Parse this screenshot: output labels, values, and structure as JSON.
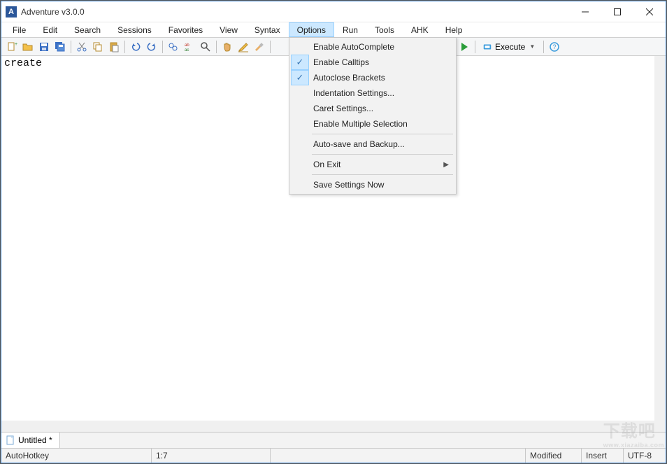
{
  "window": {
    "title": "Adventure v3.0.0",
    "app_icon_letter": "A"
  },
  "menubar": {
    "items": [
      "File",
      "Edit",
      "Search",
      "Sessions",
      "Favorites",
      "View",
      "Syntax",
      "Options",
      "Run",
      "Tools",
      "AHK",
      "Help"
    ],
    "active_index": 7
  },
  "toolbar": {
    "execute_label": "Execute"
  },
  "options_menu": {
    "items": [
      {
        "label": "Enable AutoComplete",
        "checked": false
      },
      {
        "label": "Enable Calltips",
        "checked": true
      },
      {
        "label": "Autoclose Brackets",
        "checked": true
      },
      {
        "label": "Indentation Settings...",
        "checked": false
      },
      {
        "label": "Caret Settings...",
        "checked": false
      },
      {
        "label": "Enable Multiple Selection",
        "checked": false
      },
      {
        "sep": true
      },
      {
        "label": "Auto-save and Backup...",
        "checked": false
      },
      {
        "sep": true
      },
      {
        "label": "On Exit",
        "checked": false,
        "submenu": true
      },
      {
        "sep": true
      },
      {
        "label": "Save Settings Now",
        "checked": false
      }
    ]
  },
  "editor": {
    "content": "create"
  },
  "tabs": {
    "items": [
      {
        "label": "Untitled *"
      }
    ]
  },
  "statusbar": {
    "lang": "AutoHotkey",
    "pos": "1:7",
    "modified": "Modified",
    "insert": "Insert",
    "encoding": "UTF-8"
  },
  "watermark": {
    "main": "下载吧",
    "sub": "www.xiazaiba.com"
  }
}
